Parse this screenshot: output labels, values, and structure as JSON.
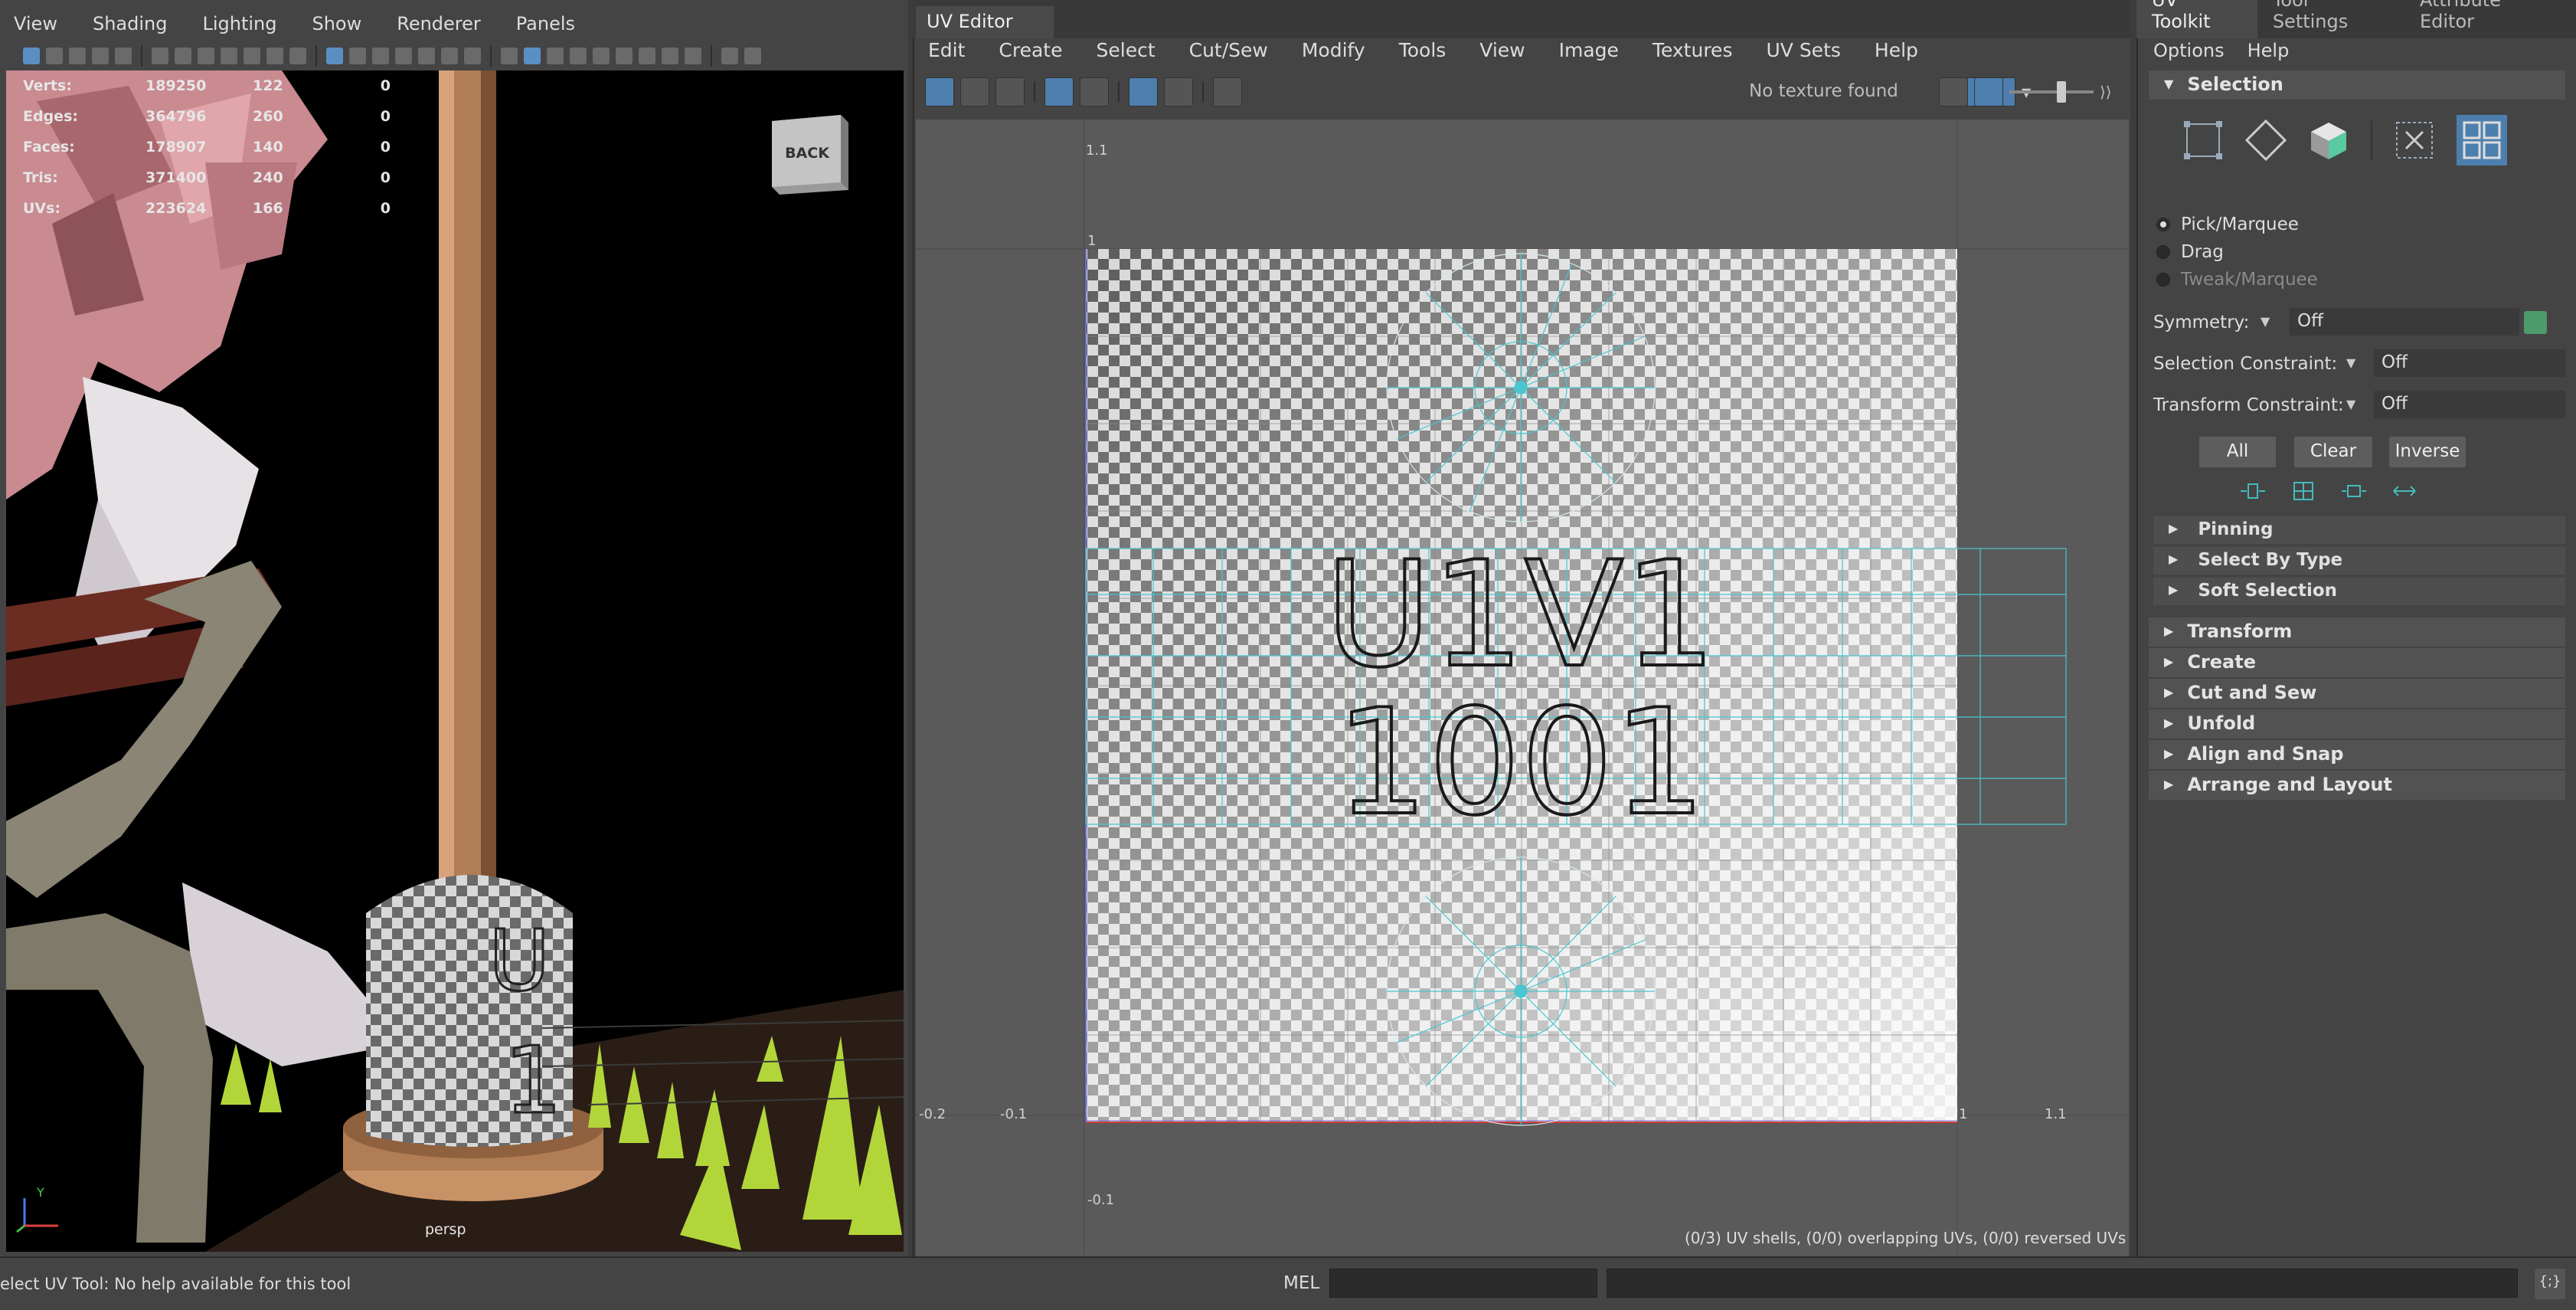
{
  "viewport": {
    "menus": [
      "View",
      "Shading",
      "Lighting",
      "Show",
      "Renderer",
      "Panels"
    ],
    "hud": [
      {
        "label": "Verts:",
        "total": "189250",
        "selected": "122",
        "extra": "0"
      },
      {
        "label": "Edges:",
        "total": "364796",
        "selected": "260",
        "extra": "0"
      },
      {
        "label": "Faces:",
        "total": "178907",
        "selected": "140",
        "extra": "0"
      },
      {
        "label": "Tris:",
        "total": "371400",
        "selected": "240",
        "extra": "0"
      },
      {
        "label": "UVs:",
        "total": "223624",
        "selected": "166",
        "extra": "0"
      }
    ],
    "view_cube_label": "BACK",
    "camera_label": "persp",
    "gizmo_y": "Y"
  },
  "uv_editor": {
    "tab_title": "UV Editor",
    "menus": [
      "Edit",
      "Create",
      "Select",
      "Cut/Sew",
      "Modify",
      "Tools",
      "View",
      "Image",
      "Textures",
      "UV Sets",
      "Help"
    ],
    "texture_status": "No texture found",
    "tile_line1": "U1V1",
    "tile_line2": "1001",
    "axis_labels": {
      "top_v": "1.1",
      "v1": "1",
      "left_u": "-0.2",
      "u_neg": "-0.1",
      "u1": "1",
      "u11": "1.1",
      "v_neg": "-0.1"
    },
    "status": "(0/3) UV shells, (0/0) overlapping UVs, (0/0) reversed UVs",
    "colors": {
      "grid_bg": "#5a5a5a",
      "uv_wire": "#49c6d0",
      "u_axis": "#d23b3b",
      "v_axis": "#6c6cd8"
    }
  },
  "toolkit": {
    "tabs": [
      "UV Toolkit",
      "Tool Settings",
      "Attribute Editor"
    ],
    "menus": [
      "Options",
      "Help"
    ],
    "selection_header": "Selection",
    "modes": [
      "Pick/Marquee",
      "Drag",
      "Tweak/Marquee"
    ],
    "symmetry_label": "Symmetry:",
    "symmetry_value": "Off",
    "selection_constraint_label": "Selection Constraint:",
    "selection_constraint_value": "Off",
    "transform_constraint_label": "Transform Constraint:",
    "transform_constraint_value": "Off",
    "btn_all": "All",
    "btn_clear": "Clear",
    "btn_inverse": "Inverse",
    "sub_sections": [
      "Pinning",
      "Select By Type",
      "Soft Selection"
    ],
    "sections": [
      "Transform",
      "Create",
      "Cut and Sew",
      "Unfold",
      "Align and Snap",
      "Arrange and Layout"
    ]
  },
  "bottom": {
    "help_text": "elect UV Tool: No help available for this tool",
    "mel_label": "MEL"
  }
}
